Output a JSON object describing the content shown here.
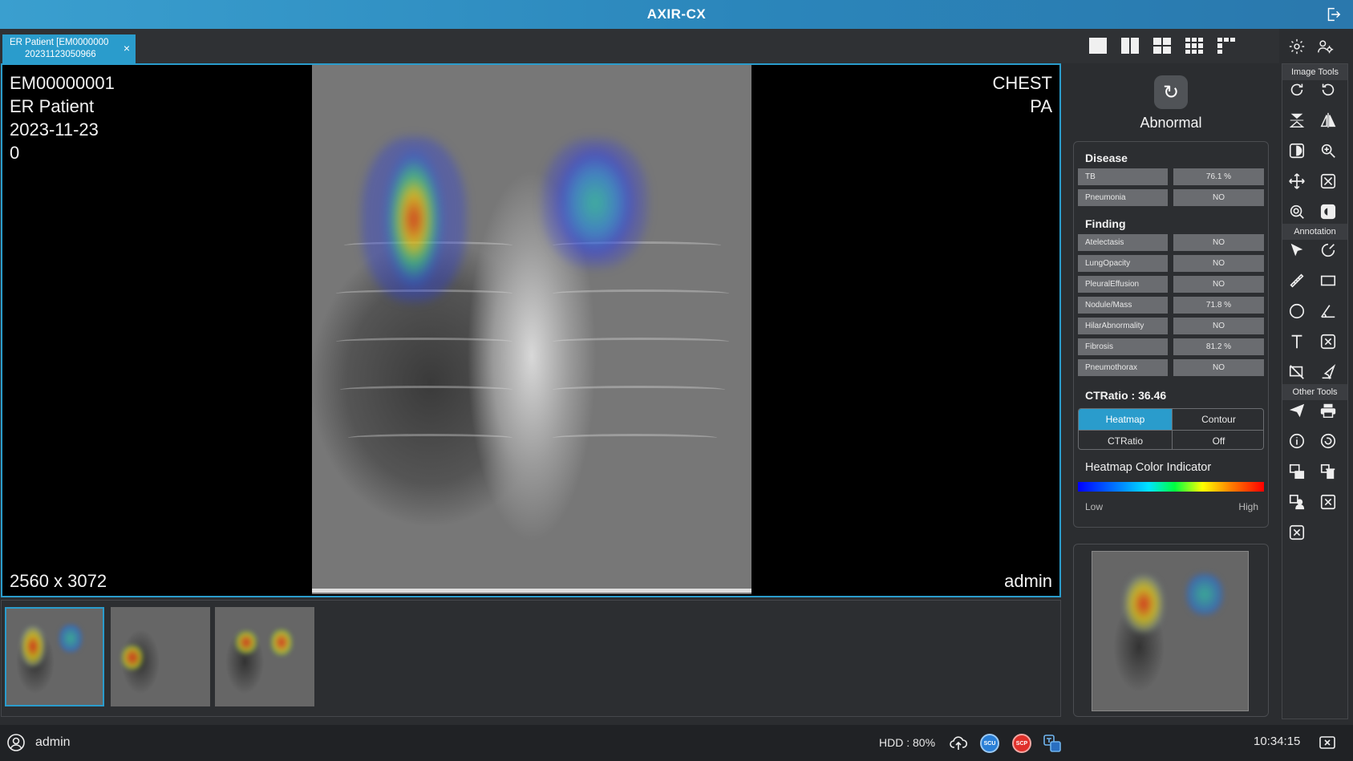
{
  "app": {
    "title": "AXIR-CX"
  },
  "tab": {
    "line1": "ER Patient [EM0000000",
    "line2": "20231123050966",
    "close": "×"
  },
  "viewer": {
    "patient_id": "EM00000001",
    "patient_name": "ER Patient",
    "date": "2023-11-23",
    "series": "0",
    "body_part": "CHEST",
    "view": "PA",
    "dimensions": "2560 x 3072",
    "operator": "admin"
  },
  "result": {
    "status": "Abnormal"
  },
  "disease": {
    "title": "Disease",
    "rows": [
      {
        "label": "TB",
        "value": "76.1 %"
      },
      {
        "label": "Pneumonia",
        "value": "NO"
      }
    ]
  },
  "finding": {
    "title": "Finding",
    "rows": [
      {
        "label": "Atelectasis",
        "value": "NO"
      },
      {
        "label": "LungOpacity",
        "value": "NO"
      },
      {
        "label": "PleuralEffusion",
        "value": "NO"
      },
      {
        "label": "Nodule/Mass",
        "value": "71.8 %"
      },
      {
        "label": "HilarAbnormality",
        "value": "NO"
      },
      {
        "label": "Fibrosis",
        "value": "81.2 %"
      },
      {
        "label": "Pneumothorax",
        "value": "NO"
      }
    ]
  },
  "ctratio": {
    "label": "CTRatio : 36.46"
  },
  "toggles": {
    "heatmap": "Heatmap",
    "contour": "Contour",
    "ctratio": "CTRatio",
    "off": "Off",
    "active": "heatmap"
  },
  "heatmap_indicator": {
    "title": "Heatmap Color Indicator",
    "low": "Low",
    "high": "High"
  },
  "tools": {
    "image_tools": "Image Tools",
    "annotation": "Annotation",
    "other_tools": "Other Tools"
  },
  "status": {
    "user": "admin",
    "hdd": "HDD : 80%",
    "time": "10:34:15",
    "scu": "SCU",
    "scp": "SCP"
  },
  "colors": {
    "accent": "#2a9ccc",
    "title_gradient_start": "#3a9fcf",
    "scu": "#2a7fd6",
    "scp": "#e0302a"
  }
}
